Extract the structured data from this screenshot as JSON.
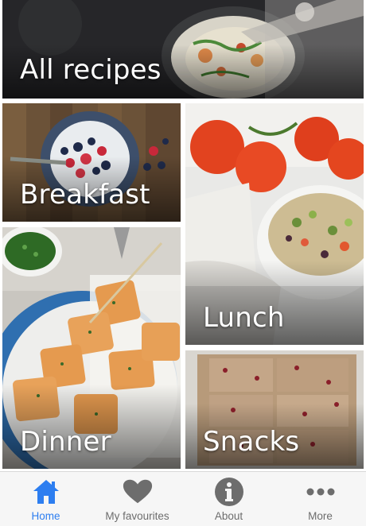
{
  "tiles": {
    "all": {
      "label": "All recipes"
    },
    "breakfast": {
      "label": "Breakfast"
    },
    "lunch": {
      "label": "Lunch"
    },
    "dinner": {
      "label": "Dinner"
    },
    "snacks": {
      "label": "Snacks"
    }
  },
  "tabbar": {
    "active_color": "#2d7ef0",
    "inactive_color": "#6d6d6d",
    "items": [
      {
        "label": "Home",
        "icon": "home-icon",
        "active": true
      },
      {
        "label": "My favourites",
        "icon": "heart-icon",
        "active": false
      },
      {
        "label": "About",
        "icon": "info-icon",
        "active": false
      },
      {
        "label": "More",
        "icon": "more-icon",
        "active": false
      }
    ]
  }
}
